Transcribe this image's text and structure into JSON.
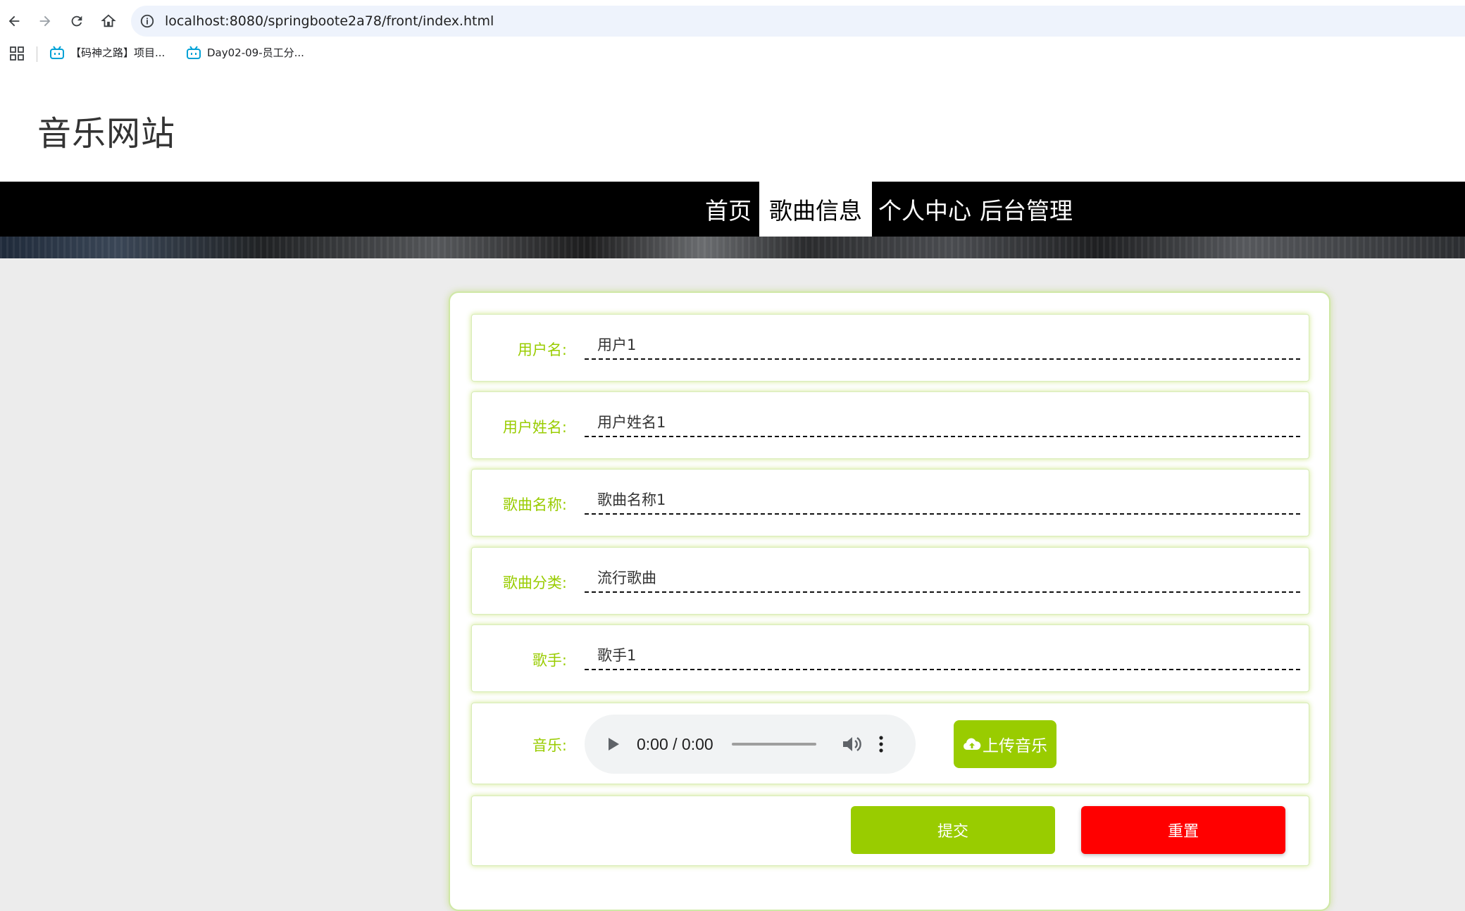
{
  "browser": {
    "url": "localhost:8080/springboote2a78/front/index.html",
    "bookmarks": [
      {
        "label": "【码神之路】项目...",
        "icon": "bilibili-icon"
      },
      {
        "label": "Day02-09-员工分...",
        "icon": "bilibili-icon"
      }
    ]
  },
  "site": {
    "title": "音乐网站"
  },
  "nav": {
    "items": [
      {
        "label": "首页",
        "active": false
      },
      {
        "label": "歌曲信息",
        "active": true
      },
      {
        "label": "个人中心",
        "active": false
      },
      {
        "label": "后台管理",
        "active": false
      }
    ]
  },
  "form": {
    "fields": [
      {
        "label": "用户名:",
        "value": "用户1"
      },
      {
        "label": "用户姓名:",
        "value": "用户姓名1"
      },
      {
        "label": "歌曲名称:",
        "value": "歌曲名称1"
      },
      {
        "label": "歌曲分类:",
        "value": "流行歌曲"
      },
      {
        "label": "歌手:",
        "value": "歌手1"
      }
    ],
    "music": {
      "label": "音乐:",
      "time": "0:00 / 0:00",
      "upload_label": "上传音乐"
    },
    "submit_label": "提交",
    "reset_label": "重置"
  },
  "colors": {
    "accent": "#99cc00",
    "danger": "#ff0000",
    "nav_bg": "#000000"
  }
}
